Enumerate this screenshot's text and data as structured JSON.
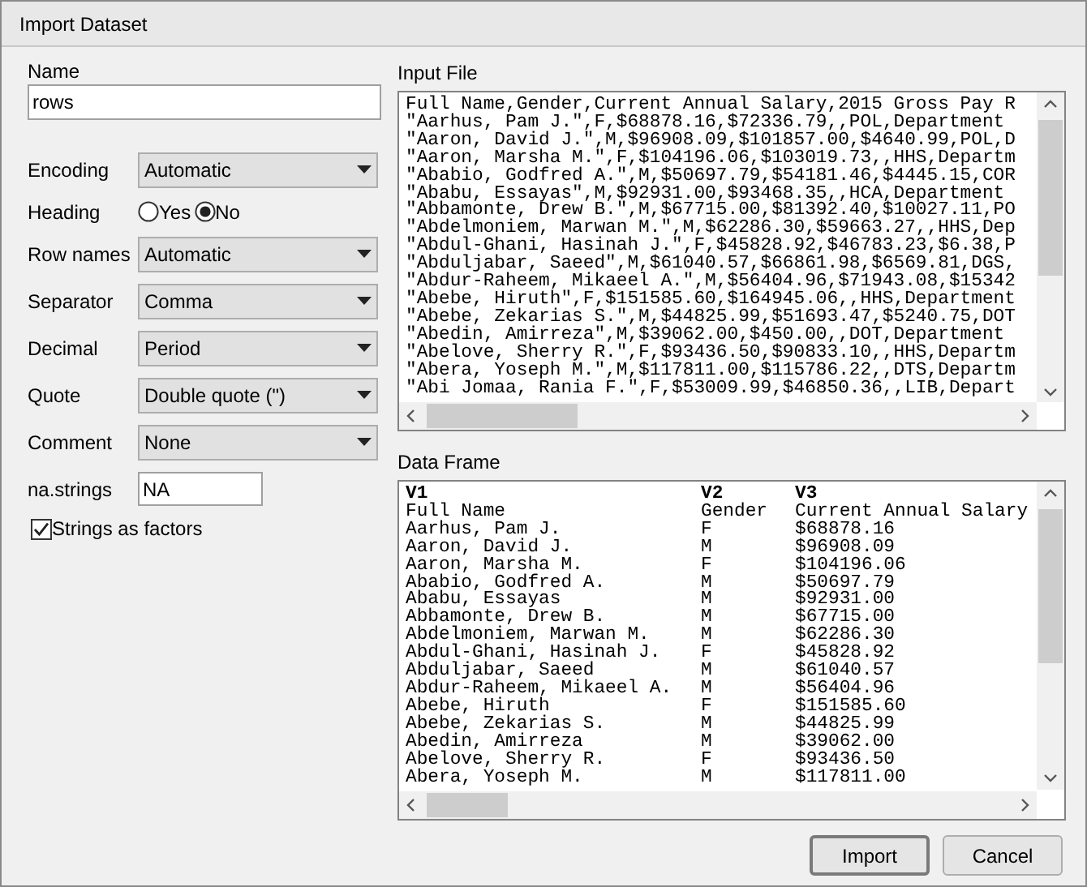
{
  "window": {
    "title": "Import Dataset"
  },
  "name_field": {
    "label": "Name",
    "value": "rows"
  },
  "options": [
    {
      "kind": "select",
      "label": "Encoding",
      "value": "Automatic"
    },
    {
      "kind": "radio",
      "label": "Heading",
      "choices": [
        {
          "label": "Yes",
          "selected": false
        },
        {
          "label": "No",
          "selected": true
        }
      ]
    },
    {
      "kind": "select",
      "label": "Row names",
      "value": "Automatic"
    },
    {
      "kind": "select",
      "label": "Separator",
      "value": "Comma"
    },
    {
      "kind": "select",
      "label": "Decimal",
      "value": "Period"
    },
    {
      "kind": "select",
      "label": "Quote",
      "value": "Double quote (\")"
    },
    {
      "kind": "select",
      "label": "Comment",
      "value": "None"
    },
    {
      "kind": "text",
      "label": "na.strings",
      "value": "NA"
    }
  ],
  "strings_as_factors": {
    "label": "Strings as factors",
    "checked": true
  },
  "input_file": {
    "label": "Input File",
    "lines": [
      "Full Name,Gender,Current Annual Salary,2015 Gross Pay R",
      "\"Aarhus, Pam J.\",F,$68878.16,$72336.79,,POL,Department",
      "\"Aaron, David J.\",M,$96908.09,$101857.00,$4640.99,POL,D",
      "\"Aaron, Marsha M.\",F,$104196.06,$103019.73,,HHS,Departm",
      "\"Ababio, Godfred A.\",M,$50697.79,$54181.46,$4445.15,COR",
      "\"Ababu, Essayas\",M,$92931.00,$93468.35,,HCA,Department",
      "\"Abbamonte, Drew B.\",M,$67715.00,$81392.40,$10027.11,PO",
      "\"Abdelmoniem, Marwan M.\",M,$62286.30,$59663.27,,HHS,Dep",
      "\"Abdul-Ghani, Hasinah J.\",F,$45828.92,$46783.23,$6.38,P",
      "\"Abduljabar, Saeed\",M,$61040.57,$66861.98,$6569.81,DGS,",
      "\"Abdur-Raheem, Mikaeel A.\",M,$56404.96,$71943.08,$15342",
      "\"Abebe, Hiruth\",F,$151585.60,$164945.06,,HHS,Department",
      "\"Abebe, Zekarias S.\",M,$44825.99,$51693.47,$5240.75,DOT",
      "\"Abedin, Amirreza\",M,$39062.00,$450.00,,DOT,Department",
      "\"Abelove, Sherry R.\",F,$93436.50,$90833.10,,HHS,Departm",
      "\"Abera, Yoseph M.\",M,$117811.00,$115786.22,,DTS,Departm",
      "\"Abi Jomaa, Rania F.\",F,$53009.99,$46850.36,,LIB,Depart"
    ]
  },
  "data_frame": {
    "label": "Data Frame",
    "columns": [
      "V1",
      "V2",
      "V3"
    ],
    "rows": [
      [
        "Full Name",
        "Gender",
        "Current Annual Salary"
      ],
      [
        "Aarhus, Pam J.",
        "F",
        "$68878.16"
      ],
      [
        "Aaron, David J.",
        "M",
        "$96908.09"
      ],
      [
        "Aaron, Marsha M.",
        "F",
        "$104196.06"
      ],
      [
        "Ababio, Godfred A.",
        "M",
        "$50697.79"
      ],
      [
        "Ababu, Essayas",
        "M",
        "$92931.00"
      ],
      [
        "Abbamonte, Drew B.",
        "M",
        "$67715.00"
      ],
      [
        "Abdelmoniem, Marwan M.",
        "M",
        "$62286.30"
      ],
      [
        "Abdul-Ghani, Hasinah J.",
        "F",
        "$45828.92"
      ],
      [
        "Abduljabar, Saeed",
        "M",
        "$61040.57"
      ],
      [
        "Abdur-Raheem, Mikaeel A.",
        "M",
        "$56404.96"
      ],
      [
        "Abebe, Hiruth",
        "F",
        "$151585.60"
      ],
      [
        "Abebe, Zekarias S.",
        "M",
        "$44825.99"
      ],
      [
        "Abedin, Amirreza",
        "M",
        "$39062.00"
      ],
      [
        "Abelove, Sherry R.",
        "F",
        "$93436.50"
      ],
      [
        "Abera, Yoseph M.",
        "M",
        "$117811.00"
      ]
    ]
  },
  "buttons": [
    {
      "label": "Import",
      "default": true
    },
    {
      "label": "Cancel",
      "default": false
    }
  ]
}
